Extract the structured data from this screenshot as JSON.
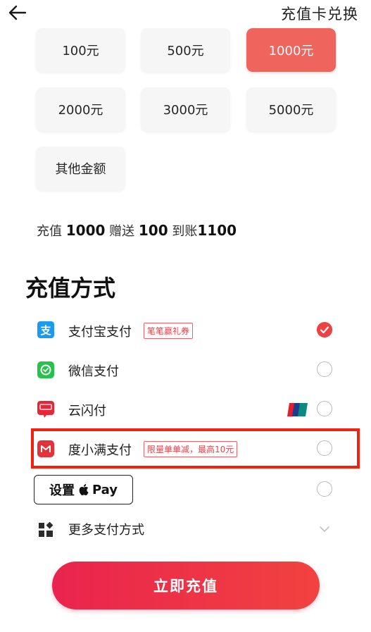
{
  "header": {
    "right_link": "充值卡兑换"
  },
  "amounts": [
    "100元",
    "500元",
    "1000元",
    "2000元",
    "3000元",
    "5000元",
    "其他金额"
  ],
  "selected_amount_index": 2,
  "summary": {
    "prefix": "充值",
    "amount": "1000",
    "gift_label": "赠送",
    "gift": "100",
    "arrive_label": "到账",
    "arrive": "1100"
  },
  "section_title": "充值方式",
  "payment_methods": [
    {
      "label": "支付宝支付",
      "promo": "笔笔赢礼券",
      "icon": "alipay-icon",
      "selected": true
    },
    {
      "label": "微信支付",
      "promo": "",
      "icon": "wechat-pay-icon",
      "selected": false
    },
    {
      "label": "云闪付",
      "promo": "",
      "icon": "cloud-quickpass-icon",
      "badge_icon": "unionpay-icon",
      "selected": false
    },
    {
      "label": "度小满支付",
      "promo": "限量单单减，最高10元",
      "icon": "duxiaoman-icon",
      "selected": false
    },
    {
      "label": "设置",
      "suffix": "Pay",
      "icon": "apple-icon",
      "selected": false
    }
  ],
  "more_payment": "更多支付方式",
  "submit_label": "立即充值",
  "colors": {
    "accent": "#f0645e",
    "check": "#ef4044",
    "highlight": "#f0220e",
    "button_start": "#e9244e",
    "button_end": "#f2423f"
  }
}
